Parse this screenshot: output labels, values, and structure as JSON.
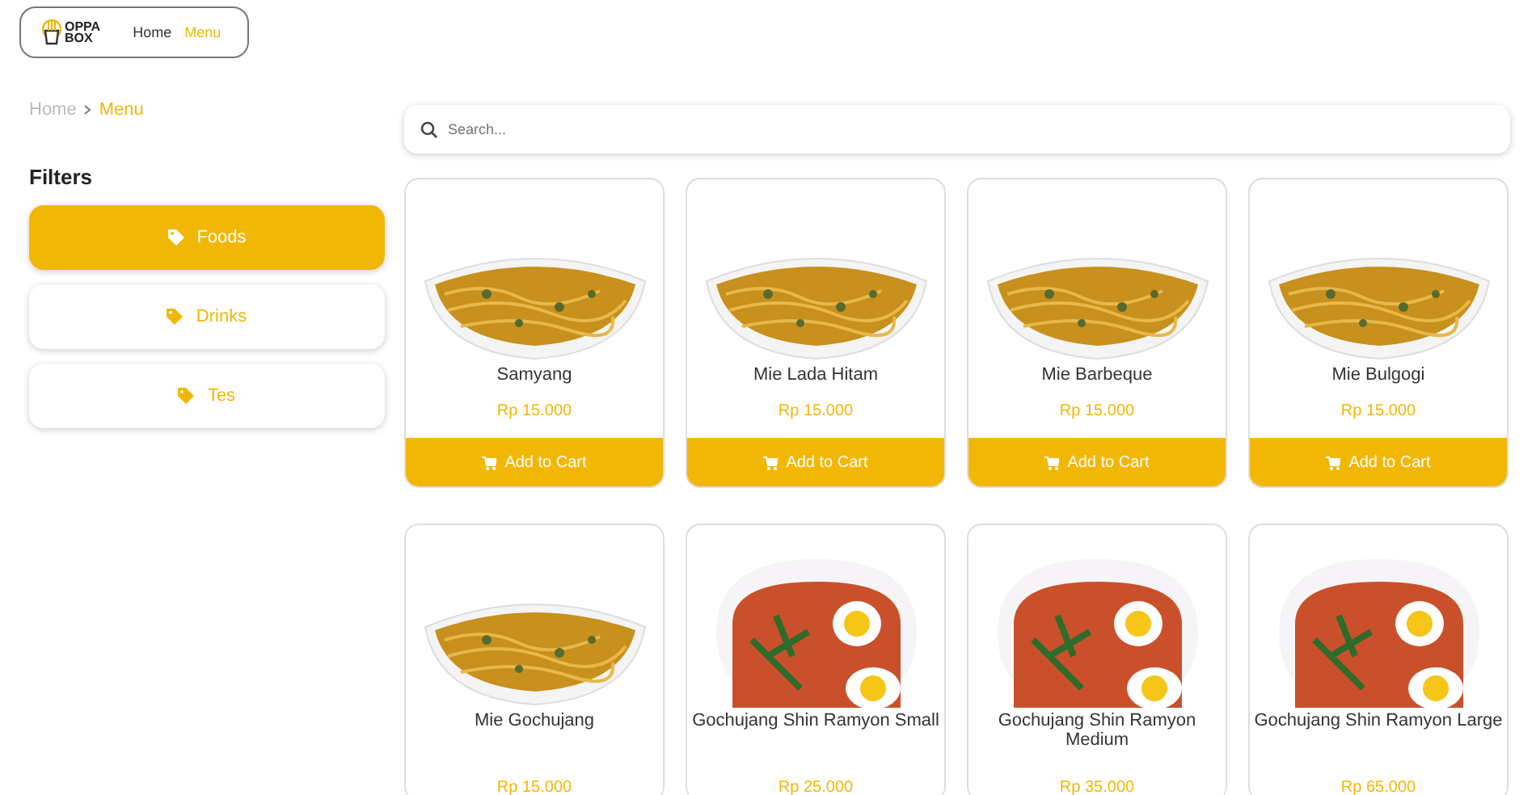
{
  "header": {
    "logo": {
      "line_1": "OPPA",
      "line_2": "BOX"
    },
    "nav": [
      {
        "label": "Home",
        "selected": false
      },
      {
        "label": "Menu",
        "selected": true
      }
    ]
  },
  "breadcrumb": [
    {
      "label": "Home",
      "selected": false
    },
    {
      "label": "Menu",
      "selected": true
    }
  ],
  "filters": {
    "title": "Filters",
    "items": [
      {
        "label": "Foods",
        "selected": true
      },
      {
        "label": "Drinks",
        "selected": false
      },
      {
        "label": "Tes",
        "selected": false
      }
    ]
  },
  "search": {
    "placeholder": "Search..."
  },
  "products": [
    {
      "name": "Samyang",
      "price": "Rp 15.000",
      "kind": "noodles",
      "button": "Add to Cart"
    },
    {
      "name": "Mie Lada Hitam",
      "price": "Rp 15.000",
      "kind": "noodles",
      "button": "Add to Cart"
    },
    {
      "name": "Mie Barbeque",
      "price": "Rp 15.000",
      "kind": "noodles",
      "button": "Add to Cart"
    },
    {
      "name": "Mie Bulgogi",
      "price": "Rp 15.000",
      "kind": "noodles",
      "button": "Add to Cart"
    },
    {
      "name": "Mie Gochujang",
      "price": "Rp 15.000",
      "kind": "noodles"
    },
    {
      "name": "Gochujang Shin Ramyon Small",
      "price": "Rp 25.000",
      "kind": "ramen"
    },
    {
      "name": "Gochujang Shin Ramyon Medium",
      "price": "Rp 35.000",
      "kind": "ramen"
    },
    {
      "name": "Gochujang Shin Ramyon Large",
      "price": "Rp 65.000",
      "kind": "ramen"
    }
  ]
}
